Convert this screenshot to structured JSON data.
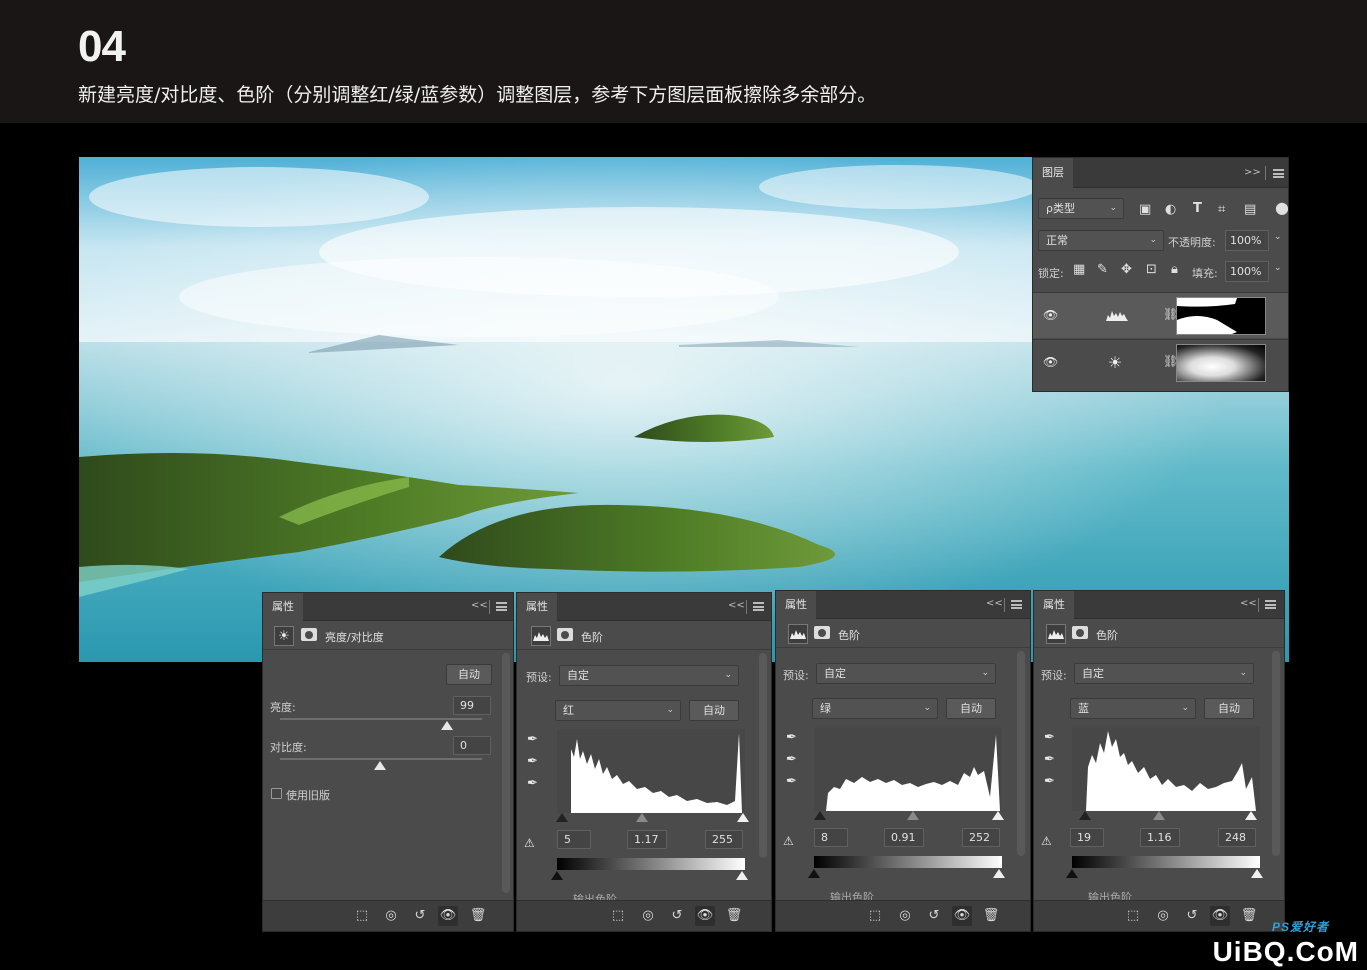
{
  "header": {
    "step_number": "04",
    "description": "新建亮度/对比度、色阶（分别调整红/绿/蓝参数）调整图层，参考下方图层面板擦除多余部分。"
  },
  "layers_panel": {
    "tab": "图层",
    "collapse": ">>",
    "filter_label": "ρ类型",
    "blend_mode": "正常",
    "opacity_label": "不透明度:",
    "opacity_value": "100%",
    "lock_label": "锁定:",
    "fill_label": "填充:",
    "fill_value": "100%",
    "layers": [
      {
        "type": "levels",
        "icon": "levels-icon",
        "selected": true
      },
      {
        "type": "brightness-contrast",
        "icon": "sun-icon",
        "selected": false
      }
    ]
  },
  "brightness_panel": {
    "tab": "属性",
    "collapse": "<<",
    "title": "亮度/对比度",
    "auto": "自动",
    "brightness_label": "亮度:",
    "brightness_value": "99",
    "contrast_label": "对比度:",
    "contrast_value": "0",
    "legacy_label": "使用旧版",
    "brightness_level": 0.83,
    "contrast_level": 0.5
  },
  "levels_panels": [
    {
      "tab": "属性",
      "collapse": "<<",
      "title": "色阶",
      "preset_label": "预设:",
      "preset": "自定",
      "channel": "红",
      "auto": "自动",
      "input_black": "5",
      "input_gamma": "1.17",
      "input_white": "255",
      "output_label": "输出色阶"
    },
    {
      "tab": "属性",
      "collapse": "<<",
      "title": "色阶",
      "preset_label": "预设:",
      "preset": "自定",
      "channel": "绿",
      "auto": "自动",
      "input_black": "8",
      "input_gamma": "0.91",
      "input_white": "252",
      "output_label": "输出色阶"
    },
    {
      "tab": "属性",
      "collapse": "<<",
      "title": "色阶",
      "preset_label": "预设:",
      "preset": "自定",
      "channel": "蓝",
      "auto": "自动",
      "input_black": "19",
      "input_gamma": "1.16",
      "input_white": "248",
      "output_label": "输出色阶"
    }
  ],
  "watermark": {
    "main": "UiBQ.CoM",
    "sub": "PS爱好者"
  },
  "colors": {
    "header_bg": "#1a1616",
    "panel_bg": "#4b4b4b",
    "panel_dark": "#3a3a3a"
  }
}
